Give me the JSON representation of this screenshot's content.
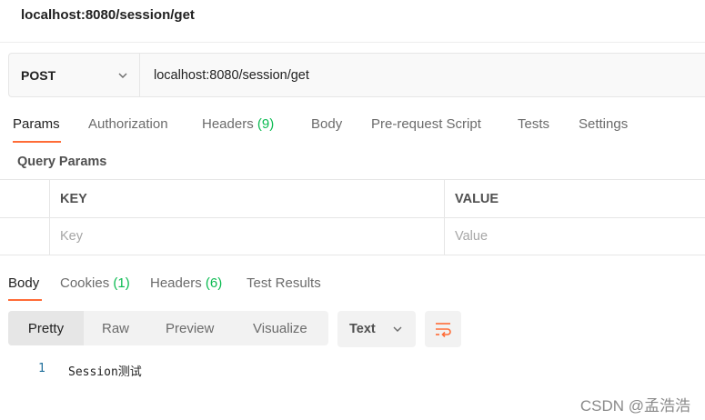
{
  "request": {
    "title": "localhost:8080/session/get",
    "method": "POST",
    "url": "localhost:8080/session/get"
  },
  "request_tabs": [
    {
      "label": "Params",
      "count": ""
    },
    {
      "label": "Authorization",
      "count": ""
    },
    {
      "label": "Headers",
      "count": "(9)"
    },
    {
      "label": "Body",
      "count": ""
    },
    {
      "label": "Pre-request Script",
      "count": ""
    },
    {
      "label": "Tests",
      "count": ""
    },
    {
      "label": "Settings",
      "count": ""
    }
  ],
  "active_request_tab": "Params",
  "query_params": {
    "section_label": "Query Params",
    "headers": {
      "key": "KEY",
      "value": "VALUE"
    },
    "placeholders": {
      "key": "Key",
      "value": "Value"
    }
  },
  "response_tabs": [
    {
      "label": "Body",
      "count": ""
    },
    {
      "label": "Cookies",
      "count": "(1)"
    },
    {
      "label": "Headers",
      "count": "(6)"
    },
    {
      "label": "Test Results",
      "count": ""
    }
  ],
  "active_response_tab": "Body",
  "view_modes": [
    "Pretty",
    "Raw",
    "Preview",
    "Visualize"
  ],
  "active_view_mode": "Pretty",
  "format": "Text",
  "response_body": {
    "line_number": "1",
    "content": "Session测试"
  },
  "watermark": "CSDN @孟浩浩",
  "colors": {
    "accent": "#ff6c37",
    "count_green": "#0cbb52"
  },
  "icons": {
    "method_dropdown": "chevron-down-icon",
    "format_dropdown": "chevron-down-icon",
    "wrap": "wrap-lines-icon"
  }
}
